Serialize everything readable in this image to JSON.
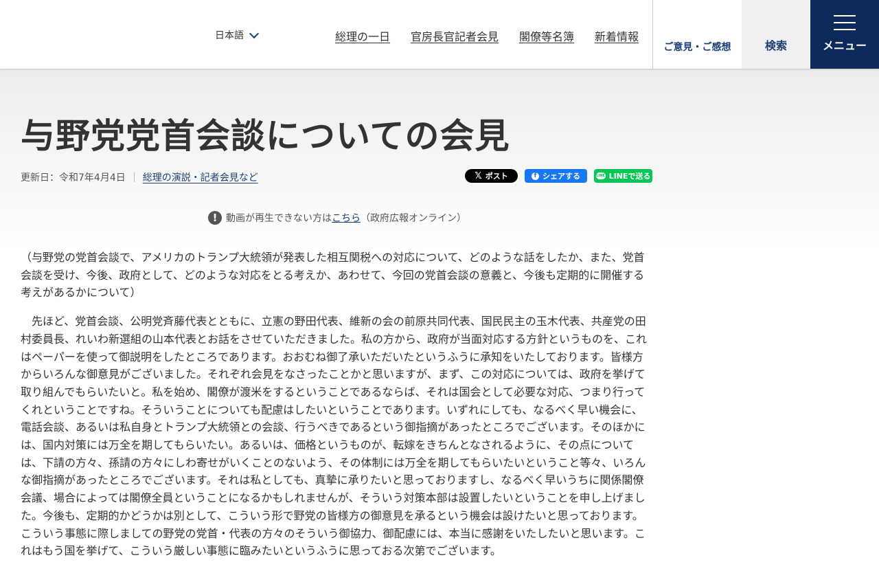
{
  "header": {
    "language": "日本語",
    "nav": [
      "総理の一日",
      "官房長官記者会見",
      "閣僚等名簿",
      "新着情報"
    ],
    "feedback": "ご意見・ご感想",
    "search": "検索",
    "menu": "メニュー"
  },
  "page": {
    "title": "与野党党首会談についての会見",
    "updated": "更新日：令和7年4月4日",
    "category": "総理の演説・記者会見など"
  },
  "share": {
    "x": "ポスト",
    "facebook": "シェアする",
    "line": "LINEで送る"
  },
  "notice": {
    "before": "動画が再生できない方は",
    "link": "こちら",
    "after": "（政府広報オンライン）"
  },
  "content": {
    "question": "（与野党の党首会談で、アメリカのトランプ大統領が発表した相互関税への対応について、どのような話をしたか、また、党首会談を受け、今後、政府として、どのような対応をとる考えか、あわせて、今回の党首会談の意義と、今後も定期的に開催する考えがあるかについて）",
    "answer": "　先ほど、党首会談、公明党斉藤代表とともに、立憲の野田代表、維新の会の前原共同代表、国民民主の玉木代表、共産党の田村委員長、れいわ新選組の山本代表とお話をさせていただきました。私の方から、政府が当面対応する方針というものを、これはペーパーを使って御説明をしたところであります。おおむね御了承いただいたというふうに承知をいたしております。皆様方からいろんな御意見がございました。それぞれ会見をなさったことかと思いますが、まず、この対応については、政府を挙げて取り組んでもらいたいと。私を始め、閣僚が渡米をするということであるならば、それは国会として必要な対応、つまり行ってくれということですね。そういうことについても配慮はしたいということであります。いずれにしても、なるべく早い機会に、電話会談、あるいは私自身とトランプ大統領との会談、行うべきであるという御指摘があったところでございます。そのほかには、国内対策には万全を期してもらいたい。あるいは、価格というものが、転嫁をきちんとなされるように、その点については、下請の方々、孫請の方々にしわ寄せがいくことのないよう、その体制には万全を期してもらいたいということ等々、いろんな御指摘があったところでございます。それは私としても、真摯に承りたいと思っておりますし、なるべく早いうちに関係閣僚会議、場合によっては閣僚全員ということになるかもしれませんが、そういう対策本部は設置したいということを申し上げました。今後も、定期的かどうかは別として、こういう形で野党の皆様方の御意見を承るという機会は設けたいと思っております。こういう事態に際しましての野党の党首・代表の方々のそういう御協力、御配慮には、本当に感謝をいたしたいと思います。これはもう国を挙げて、こういう厳しい事態に臨みたいというふうに思っておる次第でございます。"
  }
}
